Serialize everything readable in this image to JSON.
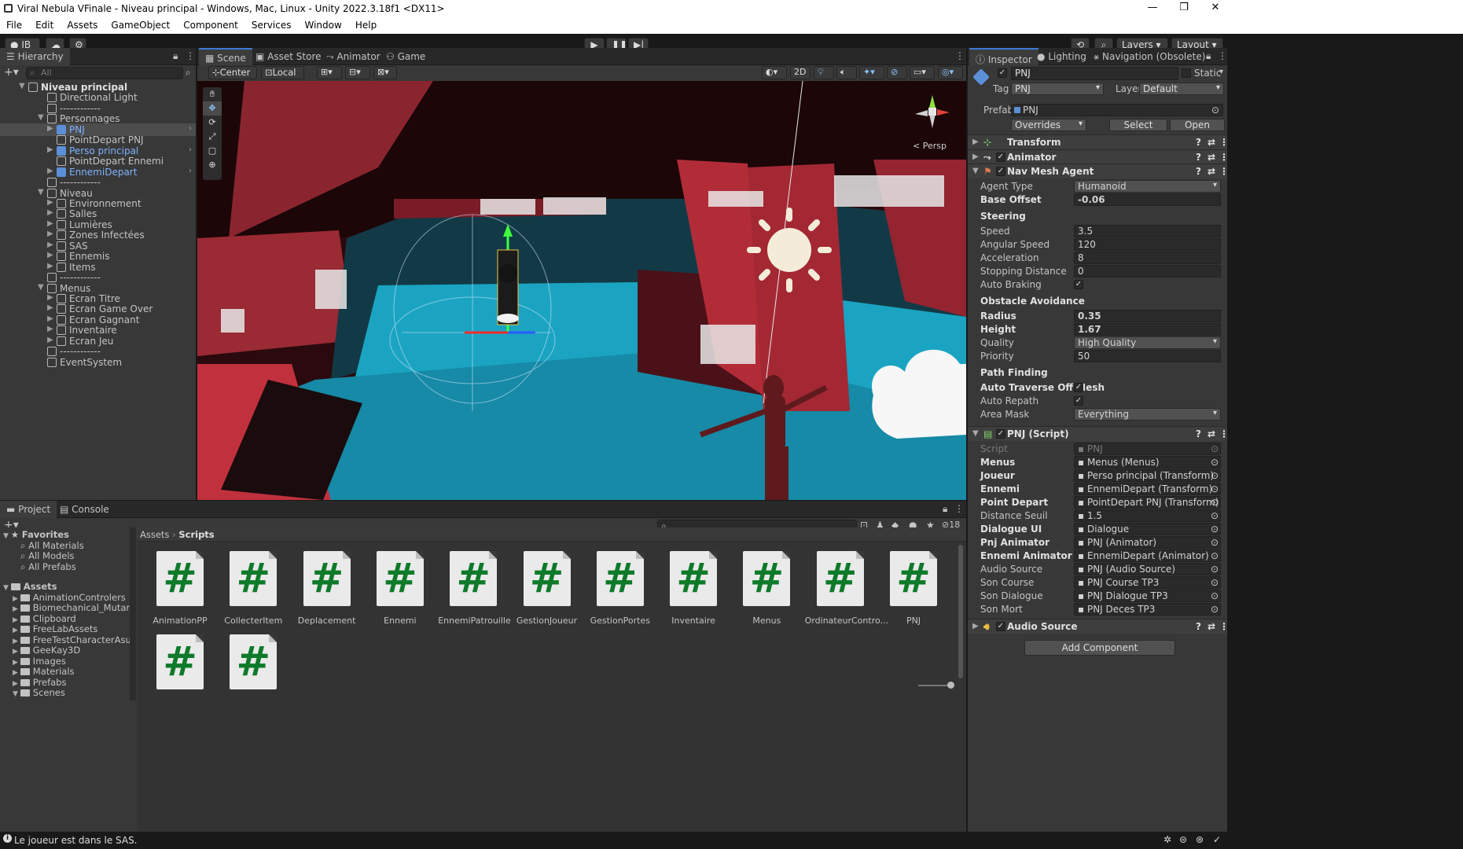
{
  "window": {
    "title": "Viral Nebula VFinale - Niveau principal - Windows, Mac, Linux - Unity 2022.3.18f1 <DX11>"
  },
  "menu": [
    "File",
    "Edit",
    "Assets",
    "GameObject",
    "Component",
    "Services",
    "Window",
    "Help"
  ],
  "toolbar": {
    "account": "IB",
    "layers": "Layers",
    "layout": "Layout"
  },
  "hierarchy": {
    "tab": "Hierarchy",
    "search_placeholder": "All",
    "items": [
      {
        "label": "Niveau principal",
        "indent": 0,
        "bold": true,
        "arrow": "▼"
      },
      {
        "label": "Directional Light",
        "indent": 1
      },
      {
        "label": "------------",
        "indent": 1
      },
      {
        "label": "Personnages",
        "indent": 1,
        "arrow": "▼"
      },
      {
        "label": "PNJ",
        "indent": 2,
        "arrow": "▶",
        "blue": true,
        "selected": true
      },
      {
        "label": "PointDepart PNJ",
        "indent": 2
      },
      {
        "label": "Perso principal",
        "indent": 2,
        "arrow": "▶",
        "blue": true
      },
      {
        "label": "PointDepart Ennemi",
        "indent": 2
      },
      {
        "label": "EnnemiDepart",
        "indent": 2,
        "arrow": "▶",
        "blue": true
      },
      {
        "label": "------------",
        "indent": 1
      },
      {
        "label": "Niveau",
        "indent": 1,
        "arrow": "▼"
      },
      {
        "label": "Environnement",
        "indent": 2,
        "arrow": "▶"
      },
      {
        "label": "Salles",
        "indent": 2,
        "arrow": "▶"
      },
      {
        "label": "Lumières",
        "indent": 2,
        "arrow": "▶"
      },
      {
        "label": "Zones Infectées",
        "indent": 2,
        "arrow": "▶"
      },
      {
        "label": "SAS",
        "indent": 2,
        "arrow": "▶"
      },
      {
        "label": "Ennemis",
        "indent": 2,
        "arrow": "▶"
      },
      {
        "label": "Items",
        "indent": 2,
        "arrow": "▶"
      },
      {
        "label": "------------",
        "indent": 1
      },
      {
        "label": "Menus",
        "indent": 1,
        "arrow": "▼"
      },
      {
        "label": "Ecran Titre",
        "indent": 2,
        "arrow": "▶"
      },
      {
        "label": "Ecran Game Over",
        "indent": 2,
        "arrow": "▶"
      },
      {
        "label": "Ecran Gagnant",
        "indent": 2,
        "arrow": "▶"
      },
      {
        "label": "Inventaire",
        "indent": 2,
        "arrow": "▶"
      },
      {
        "label": "Ecran Jeu",
        "indent": 2,
        "arrow": "▶"
      },
      {
        "label": "------------",
        "indent": 1
      },
      {
        "label": "EventSystem",
        "indent": 1
      }
    ]
  },
  "scene": {
    "tabs": [
      "Scene",
      "Asset Store",
      "Animator",
      "Game"
    ],
    "pivot": "Center",
    "space": "Local",
    "mode2d": "2D",
    "persp": "< Persp"
  },
  "inspector": {
    "tabs": [
      "Inspector",
      "Lighting",
      "Navigation (Obsolete)"
    ],
    "object_name": "PNJ",
    "static_label": "Static",
    "tag_label": "Tag",
    "tag_value": "PNJ",
    "layer_label": "Layer",
    "layer_value": "Default",
    "prefab_label": "Prefab",
    "prefab_value": "PNJ",
    "overrides": "Overrides",
    "select": "Select",
    "open": "Open",
    "components": {
      "transform": "Transform",
      "animator": "Animator",
      "navmesh": "Nav Mesh Agent",
      "script": "PNJ (Script)",
      "audio": "Audio Source"
    },
    "nav_rows": [
      {
        "k": "Agent Type",
        "v": "Humanoid",
        "dd": true
      },
      {
        "k": "Base Offset",
        "v": "-0.06",
        "b": true
      },
      {
        "section": "Steering"
      },
      {
        "k": "Speed",
        "v": "3.5"
      },
      {
        "k": "Angular Speed",
        "v": "120"
      },
      {
        "k": "Acceleration",
        "v": "8"
      },
      {
        "k": "Stopping Distance",
        "v": "0"
      },
      {
        "k": "Auto Braking",
        "check": true
      },
      {
        "section": "Obstacle Avoidance"
      },
      {
        "k": "Radius",
        "v": "0.35",
        "b": true
      },
      {
        "k": "Height",
        "v": "1.67",
        "b": true
      },
      {
        "k": "Quality",
        "v": "High Quality",
        "dd": true
      },
      {
        "k": "Priority",
        "v": "50"
      },
      {
        "section": "Path Finding"
      },
      {
        "k": "Auto Traverse Off Mesh",
        "check": true,
        "b": true
      },
      {
        "k": "Auto Repath",
        "check": true
      },
      {
        "k": "Area Mask",
        "v": "Everything",
        "dd": true
      }
    ],
    "script_rows": [
      {
        "k": "Script",
        "v": "PNJ",
        "dim": true
      },
      {
        "k": "Menus",
        "v": "Menus (Menus)",
        "b": true
      },
      {
        "k": "Joueur",
        "v": "Perso principal (Transform)",
        "b": true
      },
      {
        "k": "Ennemi",
        "v": "EnnemiDepart (Transform)",
        "b": true
      },
      {
        "k": "Point Depart",
        "v": "PointDepart PNJ (Transform)",
        "b": true
      },
      {
        "k": "Distance Seuil",
        "v": "1.5"
      },
      {
        "k": "Dialogue UI",
        "v": "Dialogue",
        "b": true
      },
      {
        "k": "Pnj Animator",
        "v": "PNJ (Animator)",
        "b": true
      },
      {
        "k": "Ennemi Animator",
        "v": "EnnemiDepart (Animator)",
        "b": true
      },
      {
        "k": "Audio Source",
        "v": "PNJ (Audio Source)"
      },
      {
        "k": "Son Course",
        "v": "PNJ Course TP3"
      },
      {
        "k": "Son Dialogue",
        "v": "PNJ Dialogue TP3"
      },
      {
        "k": "Son Mort",
        "v": "PNJ Deces TP3"
      }
    ],
    "add_component": "Add Component"
  },
  "project": {
    "tabs": [
      "Project",
      "Console"
    ],
    "hidden_count": "18",
    "favorites": {
      "label": "Favorites",
      "items": [
        "All Materials",
        "All Models",
        "All Prefabs"
      ]
    },
    "assets": {
      "label": "Assets",
      "items": [
        "AnimationControlers",
        "Biomechanical_Mutant",
        "Clipboard",
        "FreeLabAssets",
        "FreeTestCharacterAsuna",
        "GeeKay3D",
        "Images",
        "Materials",
        "Prefabs",
        "Scenes"
      ]
    },
    "breadcrumb": [
      "Assets",
      "Scripts"
    ],
    "scripts": [
      "AnimationPP",
      "CollecterItem",
      "Deplacement",
      "Ennemi",
      "EnnemiPatrouille",
      "GestionJoueur",
      "GestionPortes",
      "Inventaire",
      "Menus",
      "OrdinateurContro...",
      "PNJ",
      "",
      ""
    ]
  },
  "status": {
    "message": "Le joueur est dans le SAS."
  }
}
